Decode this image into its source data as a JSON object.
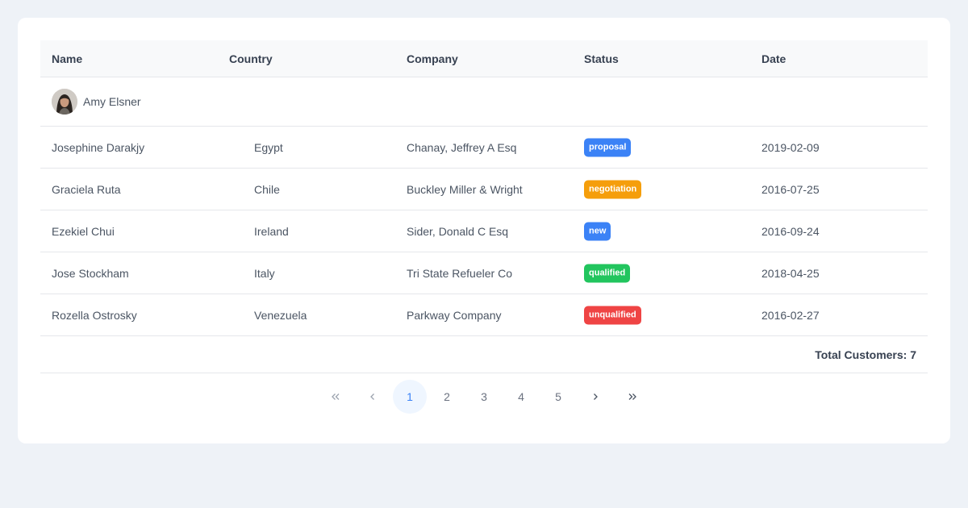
{
  "columns": {
    "name": "Name",
    "country": "Country",
    "company": "Company",
    "status": "Status",
    "date": "Date"
  },
  "group": {
    "name": "Amy Elsner"
  },
  "rows": [
    {
      "name": "Josephine Darakjy",
      "country": "Egypt",
      "company": "Chanay, Jeffrey A Esq",
      "status": "proposal",
      "status_color": "#3b82f6",
      "date": "2019-02-09"
    },
    {
      "name": "Graciela Ruta",
      "country": "Chile",
      "company": "Buckley Miller & Wright",
      "status": "negotiation",
      "status_color": "#f59e0b",
      "date": "2016-07-25"
    },
    {
      "name": "Ezekiel Chui",
      "country": "Ireland",
      "company": "Sider, Donald C Esq",
      "status": "new",
      "status_color": "#3b82f6",
      "date": "2016-09-24"
    },
    {
      "name": "Jose Stockham",
      "country": "Italy",
      "company": "Tri State Refueler Co",
      "status": "qualified",
      "status_color": "#22c55e",
      "date": "2018-04-25"
    },
    {
      "name": "Rozella Ostrosky",
      "country": "Venezuela",
      "company": "Parkway Company",
      "status": "unqualified",
      "status_color": "#ef4444",
      "date": "2016-02-27"
    }
  ],
  "footer": {
    "total_label": "Total Customers: 7"
  },
  "pager": {
    "pages": [
      "1",
      "2",
      "3",
      "4",
      "5"
    ],
    "current_page": "1",
    "icons": [
      "first-page-icon",
      "prev-page-icon",
      "next-page-icon",
      "last-page-icon"
    ]
  }
}
